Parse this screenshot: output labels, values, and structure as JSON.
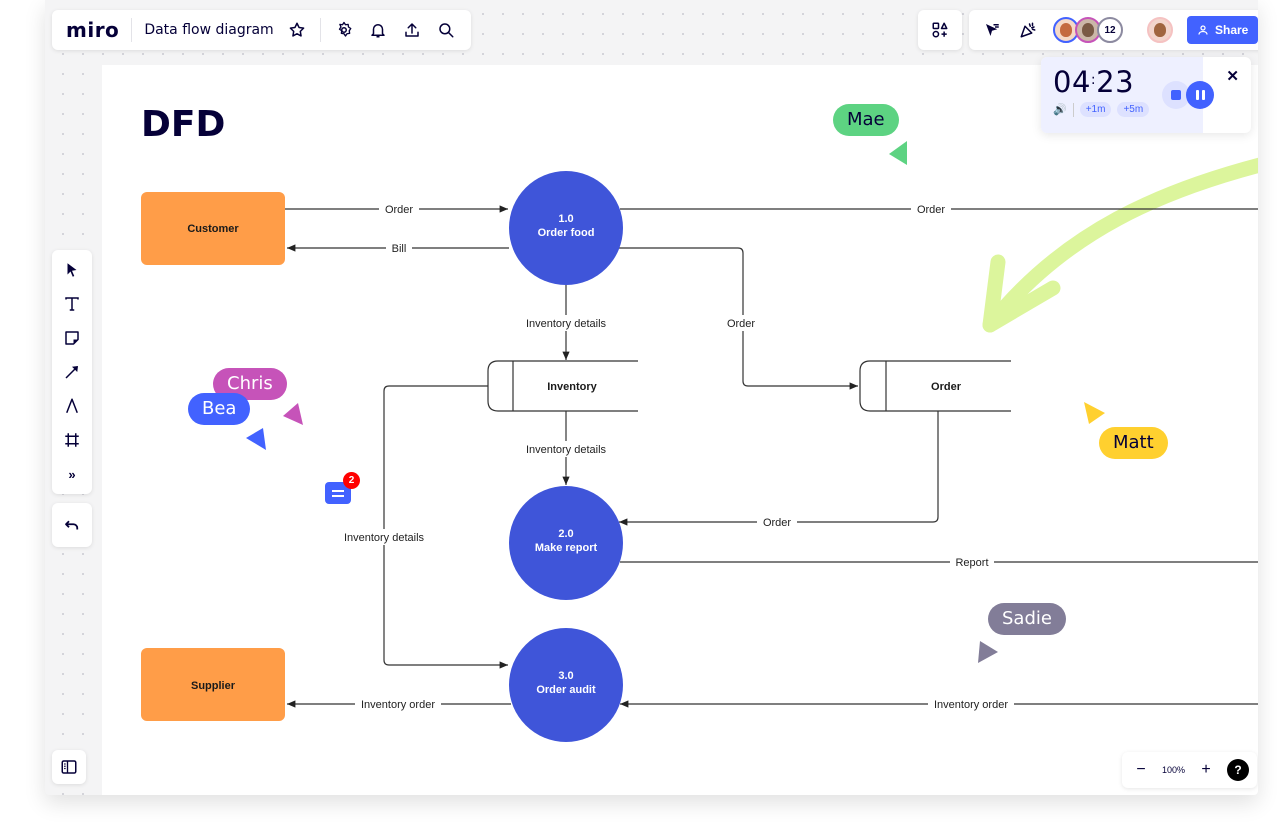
{
  "app": {
    "logo": "miro",
    "board_title": "Data flow diagram",
    "share_label": "Share",
    "collaborator_count": "12",
    "zoom_level": "100%",
    "help_label": "?"
  },
  "header_icons": [
    "star-icon",
    "settings-icon",
    "bell-icon",
    "upload-icon",
    "search-icon"
  ],
  "toolbar_icons": [
    "select-icon",
    "text-icon",
    "sticky-note-icon",
    "arrow-icon",
    "pen-icon",
    "frame-icon",
    "more-tools-icon"
  ],
  "timer": {
    "minutes": "04",
    "seconds": "23",
    "add_1": "+1m",
    "add_5": "+5m"
  },
  "diagram": {
    "title": "DFD",
    "entities": [
      {
        "label": "Customer"
      },
      {
        "label": "Supplier"
      }
    ],
    "processes": [
      {
        "id": "1.0",
        "label": "Order food"
      },
      {
        "id": "2.0",
        "label": "Make report"
      },
      {
        "id": "3.0",
        "label": "Order audit"
      }
    ],
    "stores": [
      {
        "label": "Inventory"
      },
      {
        "label": "Order"
      }
    ],
    "flows": {
      "customer_order": "Order",
      "bill": "Bill",
      "order_right": "Order",
      "inventory_details_1": "Inventory details",
      "order_to_store": "Order",
      "inventory_details_2": "Inventory details",
      "inventory_details_left": "Inventory details",
      "order_to_report": "Order",
      "report": "Report",
      "inventory_order_left": "Inventory order",
      "inventory_order_right": "Inventory order"
    },
    "colors": {
      "process": "#3f55d9",
      "entity": "#ff9d48",
      "highlight_arrow": "#dcf59c"
    }
  },
  "cursors": [
    {
      "name": "Mae",
      "color": "#5dd382"
    },
    {
      "name": "Chris",
      "color": "#c653b9"
    },
    {
      "name": "Bea",
      "color": "#4262ff"
    },
    {
      "name": "Matt",
      "color": "#ffd02f"
    },
    {
      "name": "Sadie",
      "color": "#827d98"
    }
  ],
  "comments": {
    "count": "2"
  }
}
